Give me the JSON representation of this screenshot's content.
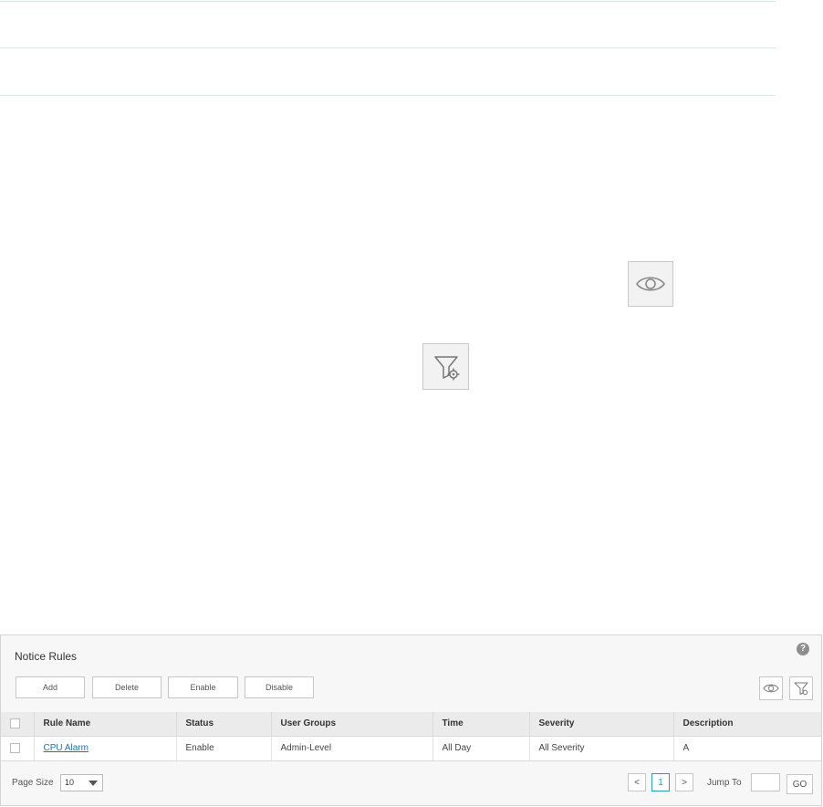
{
  "panel": {
    "title": "Notice Rules",
    "help_label": "?"
  },
  "toolbar": {
    "add_label": "Add",
    "delete_label": "Delete",
    "enable_label": "Enable",
    "disable_label": "Disable"
  },
  "table": {
    "columns": [
      "Rule Name",
      "Status",
      "User Groups",
      "Time",
      "Severity",
      "Description"
    ],
    "rows": [
      {
        "rule_name": "CPU Alarm",
        "status": "Enable",
        "user_groups": "Admin-Level",
        "time": "All Day",
        "severity": "All Severity",
        "description": "A"
      }
    ]
  },
  "footer": {
    "page_size_label": "Page Size",
    "page_size_value": "10",
    "prev_label": "<",
    "current_page": "1",
    "next_label": ">",
    "jump_to_label": "Jump To",
    "jump_input_value": "",
    "go_label": "GO"
  },
  "icons": {
    "view": "eye-icon",
    "filter": "filter-settings-icon"
  },
  "colors": {
    "link": "#1f6fc5",
    "active_page": "#2a9bc3"
  }
}
